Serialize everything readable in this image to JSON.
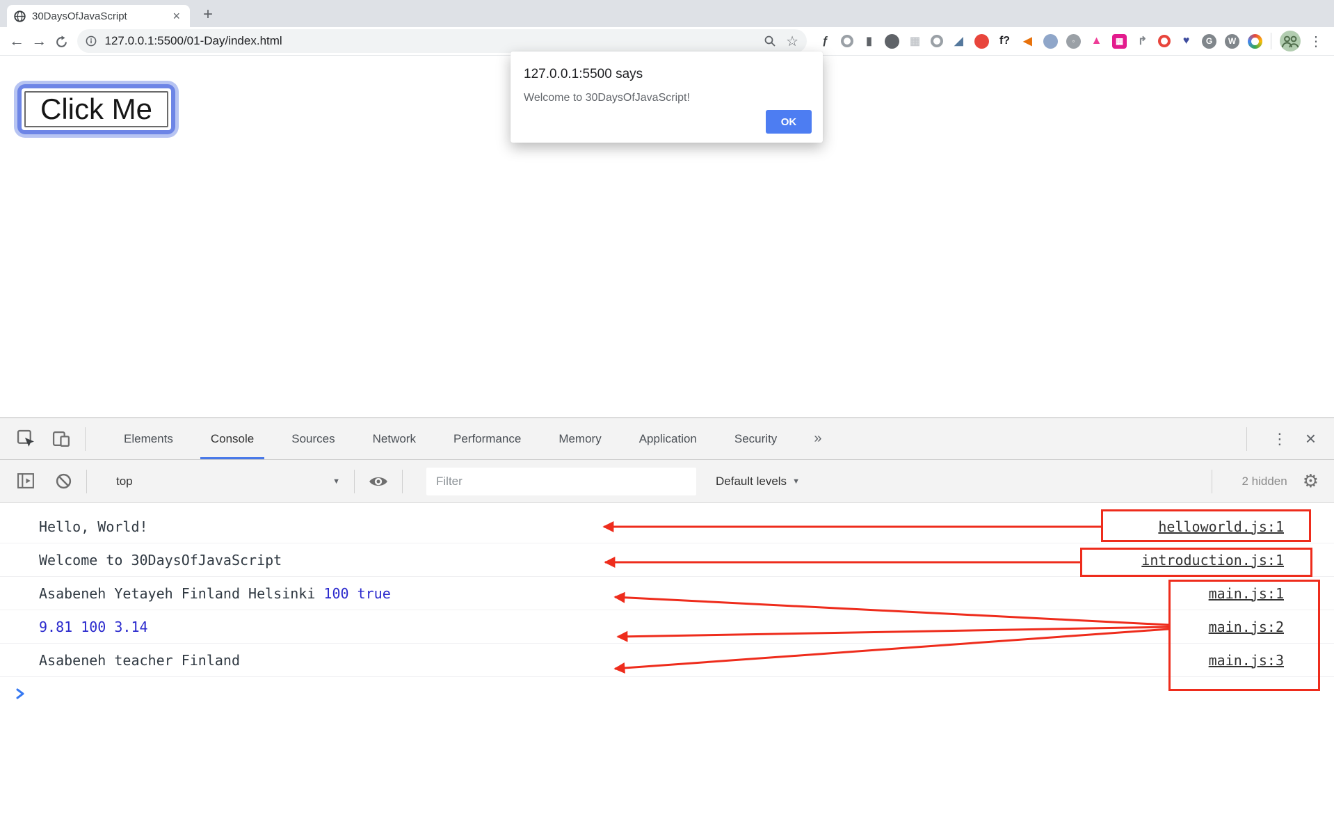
{
  "browser": {
    "tab_title": "30DaysOfJavaScript",
    "tab_close_glyph": "×",
    "new_tab_glyph": "+",
    "back_glyph": "←",
    "forward_glyph": "→",
    "url": "127.0.0.1:5500/01-Day/index.html",
    "bookmark_star_glyph": "☆",
    "menu_glyph": "⋮",
    "profile_color": "#b2cdb0",
    "extensions": [
      {
        "name": "extension-script-f",
        "kind": "text",
        "glyph": "ƒ",
        "color": "#3c4043"
      },
      {
        "name": "extension-dial",
        "kind": "ring",
        "color": "#9aa0a6"
      },
      {
        "name": "extension-columns",
        "kind": "text",
        "glyph": "▮",
        "color": "#5f6368"
      },
      {
        "name": "extension-bug",
        "kind": "chip",
        "glyph": "",
        "bg": "#5f6368"
      },
      {
        "name": "extension-grid-light",
        "kind": "text",
        "glyph": "▦",
        "color": "#c6c9cd"
      },
      {
        "name": "extension-brackets-circle",
        "kind": "ring",
        "color": "#9aa0a6"
      },
      {
        "name": "extension-eyedropper",
        "kind": "text",
        "glyph": "◢",
        "color": "#54789c"
      },
      {
        "name": "extension-red-blob",
        "kind": "chip",
        "glyph": "",
        "bg": "#e8453c"
      },
      {
        "name": "extension-f-question",
        "kind": "text",
        "glyph": "f?",
        "color": "#202124"
      },
      {
        "name": "extension-megaphone",
        "kind": "text",
        "glyph": "◀",
        "color": "#e8710a"
      },
      {
        "name": "extension-blue-swirl",
        "kind": "chip",
        "glyph": "",
        "bg": "#8fa6c9"
      },
      {
        "name": "extension-camera",
        "kind": "chip",
        "glyph": "◦",
        "bg": "#9aa0a6"
      },
      {
        "name": "extension-bell-pink",
        "kind": "text",
        "glyph": "▲",
        "color": "#ee3d97"
      },
      {
        "name": "extension-magenta-box",
        "kind": "chip-square",
        "glyph": "▦",
        "bg": "#e31b8d"
      },
      {
        "name": "extension-corner-arrow",
        "kind": "text",
        "glyph": "↱",
        "color": "#80868b"
      },
      {
        "name": "extension-red-ring",
        "kind": "ring",
        "color": "#e8453c"
      },
      {
        "name": "extension-heart-search",
        "kind": "text",
        "glyph": "♥",
        "color": "#3d4b9e"
      },
      {
        "name": "extension-g-circle",
        "kind": "chip",
        "glyph": "G",
        "bg": "#80868b"
      },
      {
        "name": "extension-w-circle",
        "kind": "chip",
        "glyph": "W",
        "bg": "#80868b"
      },
      {
        "name": "extension-rainbow-ring",
        "kind": "rainbow"
      }
    ]
  },
  "page": {
    "click_button_label": "Click Me"
  },
  "dialog": {
    "title": "127.0.0.1:5500 says",
    "message": "Welcome to 30DaysOfJavaScript!",
    "ok_label": "OK",
    "ok_bg": "#4d7df2"
  },
  "devtools": {
    "tabs": [
      "Elements",
      "Console",
      "Sources",
      "Network",
      "Performance",
      "Memory",
      "Application",
      "Security"
    ],
    "active_tab": "Console",
    "more_tabs_glyph": "»",
    "menu_glyph": "⋮",
    "close_glyph": "×",
    "accent_color": "#4878e8",
    "toolbar": {
      "context_selector": "top",
      "dropdown_glyph": "▼",
      "filter_placeholder": "Filter",
      "levels_label": "Default levels",
      "hidden_badge": "2 hidden",
      "settings_glyph": "⚙"
    },
    "console_rows": [
      {
        "plain": "Hello, World!",
        "value": "",
        "source": "helloworld.js:1"
      },
      {
        "plain": "Welcome to 30DaysOfJavaScript",
        "value": "",
        "source": "introduction.js:1"
      },
      {
        "plain": "Asabeneh Yetayeh Finland Helsinki ",
        "value": "100 true",
        "source": "main.js:1"
      },
      {
        "plain": "",
        "value": "9.81 100 3.14",
        "source": "main.js:2"
      },
      {
        "plain": "Asabeneh teacher Finland",
        "value": "",
        "source": "main.js:3"
      }
    ],
    "text_color": "#303942",
    "value_color": "#2b2acd",
    "source_link_color": "#333333",
    "prompt_color": "#3679f2"
  },
  "annotations": {
    "color": "#ee2c1c"
  }
}
